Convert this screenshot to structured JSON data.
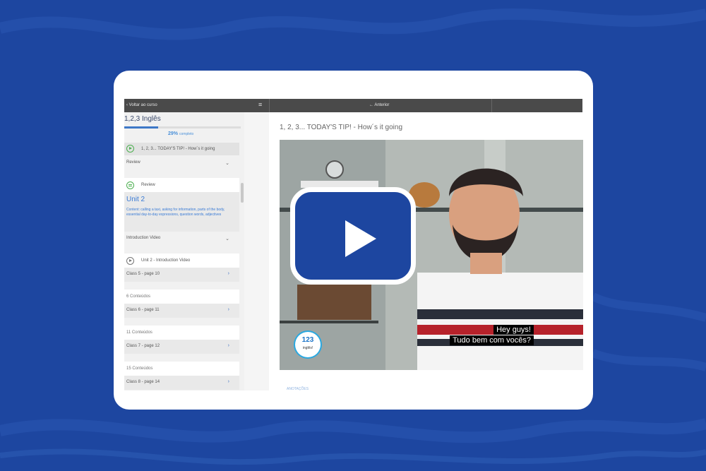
{
  "colors": {
    "background": "#1d46a0",
    "card": "#ffffff",
    "accent": "#3a7bd5",
    "play_button": "#1d46a0"
  },
  "topbar": {
    "back_label": "Voltar ao curso",
    "menu_icon": "menu-icon",
    "prev_label": "Anterior"
  },
  "sidebar": {
    "course_title": "1,2,3 Inglês",
    "progress_percent": "29%",
    "progress_suffix": "completo",
    "progress_value": 0.29,
    "active_lesson": "1, 2, 3... TODAY'S TIP! - How´s it going",
    "review_section": "Review",
    "review_lesson": "Review",
    "unit_title": "Unit 2",
    "unit_description": "Content: calling a taxi, asking for information, parts of the body, essential day-to-day expressions, question words, adjectives",
    "intro_section": "Introduction Video",
    "intro_lesson": "Unit 2 - Introduction Video",
    "classes": [
      {
        "label": "Class 5 - page 10"
      },
      {
        "label": "Class 6 - page 11"
      },
      {
        "label": "Class 7 - page 12"
      },
      {
        "label": "Class 8 - page 14"
      }
    ],
    "counts": [
      "6 Conteúdos",
      "11 Conteúdos",
      "15 Conteúdos"
    ]
  },
  "main": {
    "lesson_title": "1, 2, 3... TODAY'S TIP! - How´s it going",
    "subtitle_line1": "Hey guys!",
    "subtitle_line2": "Tudo bem com vocês?",
    "logo_text": "123",
    "logo_sub": "inglês!",
    "caption_link": "ANOTAÇÕES"
  }
}
